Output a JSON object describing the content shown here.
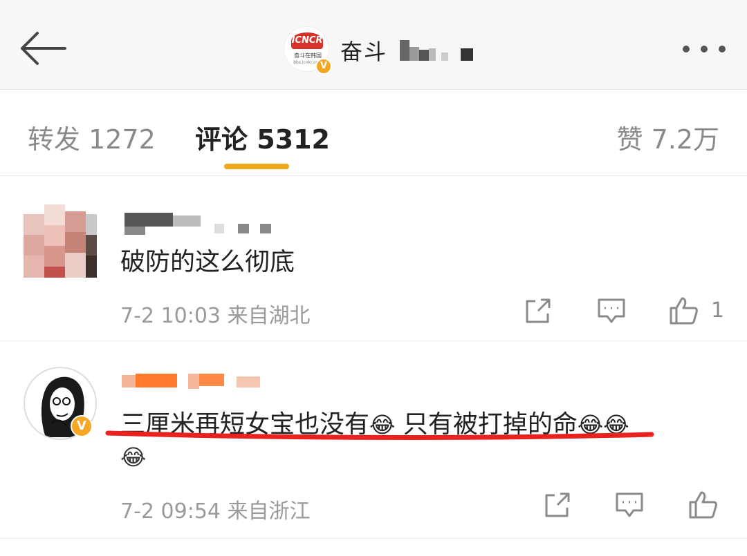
{
  "header": {
    "account_name": "奋斗",
    "logo_label": "ICNCR",
    "logo_text": "奋斗在韩国",
    "logo_sub": "bbs.icnkr.com",
    "verified_mark": "V"
  },
  "tabs": {
    "repost": "转发 1272",
    "comments": "评论 5312",
    "likes": "赞 7.2万"
  },
  "comments": [
    {
      "text": "破防的这么彻底",
      "time": "7-2 10:03",
      "location": "来自湖北",
      "like_count": "1"
    },
    {
      "text": "三厘米再短女宝也没有",
      "emoji_1": "😂",
      "text_b": " 只有被打掉的命",
      "emoji_2": "😂😂",
      "emoji_3": "😂",
      "time": "7-2 09:54",
      "location": "来自浙江",
      "verified_mark": "V"
    }
  ],
  "colors": {
    "accent": "#f0a91e",
    "verified": "#f5a623",
    "highlight": "#e8231f"
  }
}
